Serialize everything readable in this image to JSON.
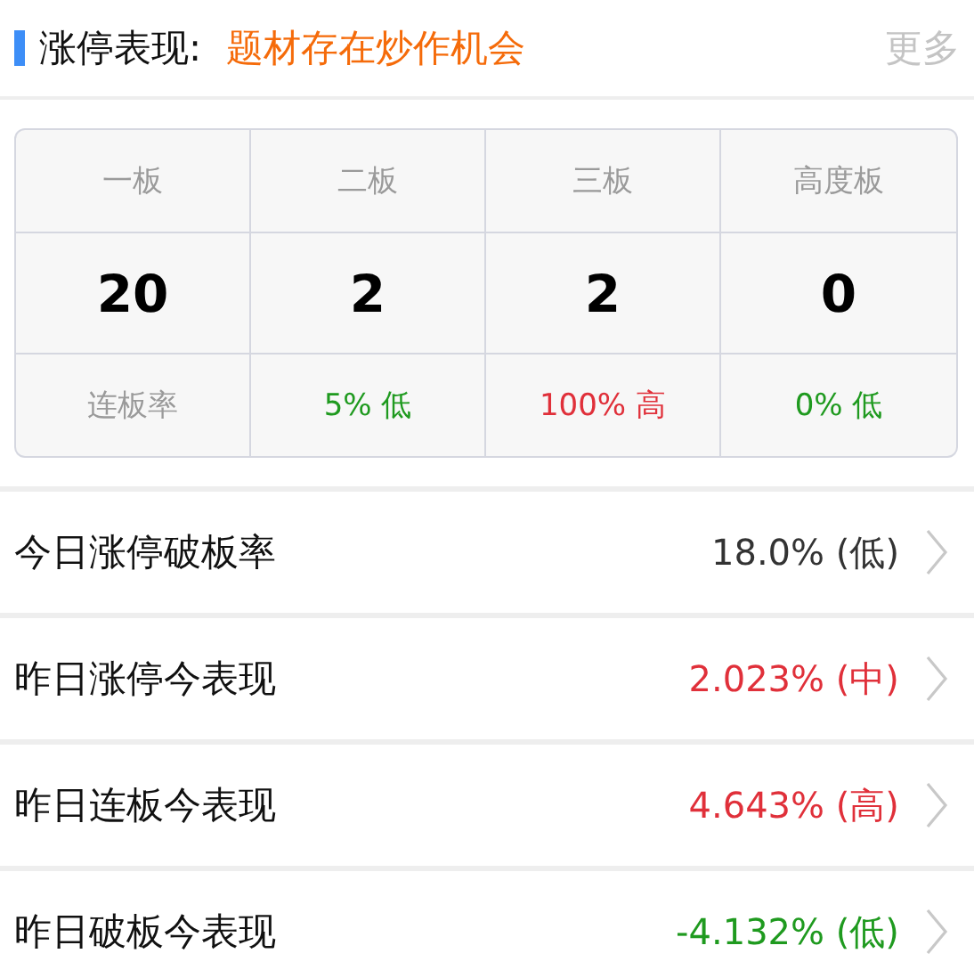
{
  "header": {
    "title": "涨停表现:",
    "highlight": "题材存在炒作机会",
    "more": "更多"
  },
  "board_table": {
    "headers": [
      "一板",
      "二板",
      "三板",
      "高度板"
    ],
    "counts": [
      "20",
      "2",
      "2",
      "0"
    ],
    "rate_label": "连板率",
    "rates": [
      {
        "text": "5% 低",
        "color": "#1f9a1f"
      },
      {
        "text": "100% 高",
        "color": "#e0303a"
      },
      {
        "text": "0% 低",
        "color": "#1f9a1f"
      }
    ]
  },
  "metrics": [
    {
      "label": "今日涨停破板率",
      "value": "18.0% (低)",
      "color": "#333333"
    },
    {
      "label": "昨日涨停今表现",
      "value": "2.023% (中)",
      "color": "#e0303a"
    },
    {
      "label": "昨日连板今表现",
      "value": "4.643% (高)",
      "color": "#e0303a"
    },
    {
      "label": "昨日破板今表现",
      "value": "-4.132% (低)",
      "color": "#1f9a1f"
    }
  ]
}
